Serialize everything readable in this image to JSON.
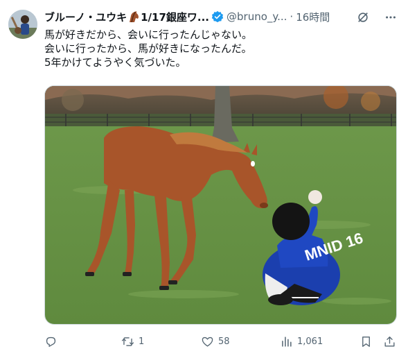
{
  "author": {
    "display_name": "ブルーノ・ユウキ",
    "emoji_icon": "horse-head-emoji-icon",
    "display_name_suffix": "1/17銀座ワ...",
    "verified": true,
    "handle": "@bruno_y...",
    "separator": "·",
    "time": "16時間"
  },
  "body": {
    "lines": [
      "馬が好きだから、会いに行ったんじゃない。",
      "会いに行ったから、馬が好きになったんだ。",
      "5年かけてようやく気づいた。"
    ]
  },
  "media": {
    "description_icon": "photo",
    "jersey_text": "MNID 16"
  },
  "actions": {
    "reply": {
      "icon": "reply-icon",
      "count": ""
    },
    "retweet": {
      "icon": "retweet-icon",
      "count": "1"
    },
    "like": {
      "icon": "heart-icon",
      "count": "58"
    },
    "views": {
      "icon": "views-icon",
      "count": "1,061"
    },
    "bookmark": {
      "icon": "bookmark-icon"
    },
    "share": {
      "icon": "share-icon"
    }
  },
  "colors": {
    "text": "#0f1419",
    "secondary": "#536471",
    "verified": "#1d9bf0"
  }
}
